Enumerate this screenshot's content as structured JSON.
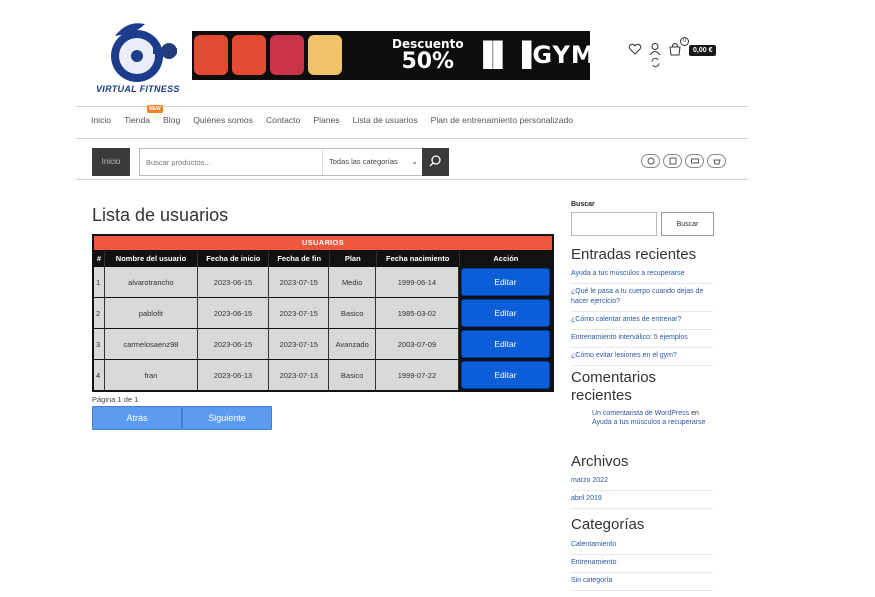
{
  "header": {
    "logo_text": "VIRTUAL FITNESS",
    "banner": {
      "line1": "Descuento",
      "line2": "50%",
      "gym": "GYM"
    },
    "cart": {
      "count": "0",
      "price": "0,00 €"
    }
  },
  "nav": {
    "items": [
      {
        "label": "Inicio"
      },
      {
        "label": "Tienda",
        "badge": "NEW"
      },
      {
        "label": "Blog"
      },
      {
        "label": "Quiénes somos"
      },
      {
        "label": "Contacto"
      },
      {
        "label": "Planes"
      },
      {
        "label": "Lista de usuarios"
      },
      {
        "label": "Plan de entrenamiento personalizado"
      }
    ]
  },
  "searchbar": {
    "home_label": "Inicio",
    "placeholder": "Buscar productos...",
    "category": "Todas las categorías"
  },
  "main": {
    "title": "Lista de usuarios",
    "table": {
      "caption": "USUARIOS",
      "headers": [
        "#",
        "Nombre del usuario",
        "Fecha de inicio",
        "Fecha de fin",
        "Plan",
        "Fecha nacimiento",
        "Acción"
      ],
      "rows": [
        {
          "n": "1",
          "user": "alvarotrancho",
          "start": "2023-06-15",
          "end": "2023-07-15",
          "plan": "Medio",
          "birth": "1999-06-14",
          "action": "Editar"
        },
        {
          "n": "2",
          "user": "pablofit",
          "start": "2023-06-15",
          "end": "2023-07-15",
          "plan": "Basico",
          "birth": "1985-03-02",
          "action": "Editar"
        },
        {
          "n": "3",
          "user": "carmelosaenz98",
          "start": "2023-06-15",
          "end": "2023-07-15",
          "plan": "Avanzado",
          "birth": "2003-07-09",
          "action": "Editar"
        },
        {
          "n": "4",
          "user": "fran",
          "start": "2023-06-13",
          "end": "2023-07-13",
          "plan": "Basico",
          "birth": "1999-07-22",
          "action": "Editar"
        }
      ]
    },
    "pager": {
      "text": "Página 1 de 1",
      "prev": "Atrás",
      "next": "Siguiente"
    }
  },
  "sidebar": {
    "search_label": "Buscar",
    "search_button": "Buscar",
    "recent_posts": {
      "title": "Entradas recientes",
      "items": [
        "Ayuda a tus músculos a recuperarse",
        "¿Qué le pasa a tu cuerpo cuando dejas de hacer ejercicio?",
        "¿Cómo calentar antes de entrenar?",
        "Entrenamiento interválico: 5 ejemplos",
        "¿Cómo evitar lesiones en el gym?"
      ]
    },
    "recent_comments": {
      "title": "Comentarios recientes",
      "author": "Un comentarista de WordPress",
      "connector": "en",
      "post": "Ayuda a tus músculos a recuperarse"
    },
    "archives": {
      "title": "Archivos",
      "items": [
        "marzo 2022",
        "abril 2019"
      ]
    },
    "categories": {
      "title": "Categorías",
      "items": [
        "Calentamiento",
        "Entrenamiento",
        "Sin categoría"
      ]
    }
  }
}
